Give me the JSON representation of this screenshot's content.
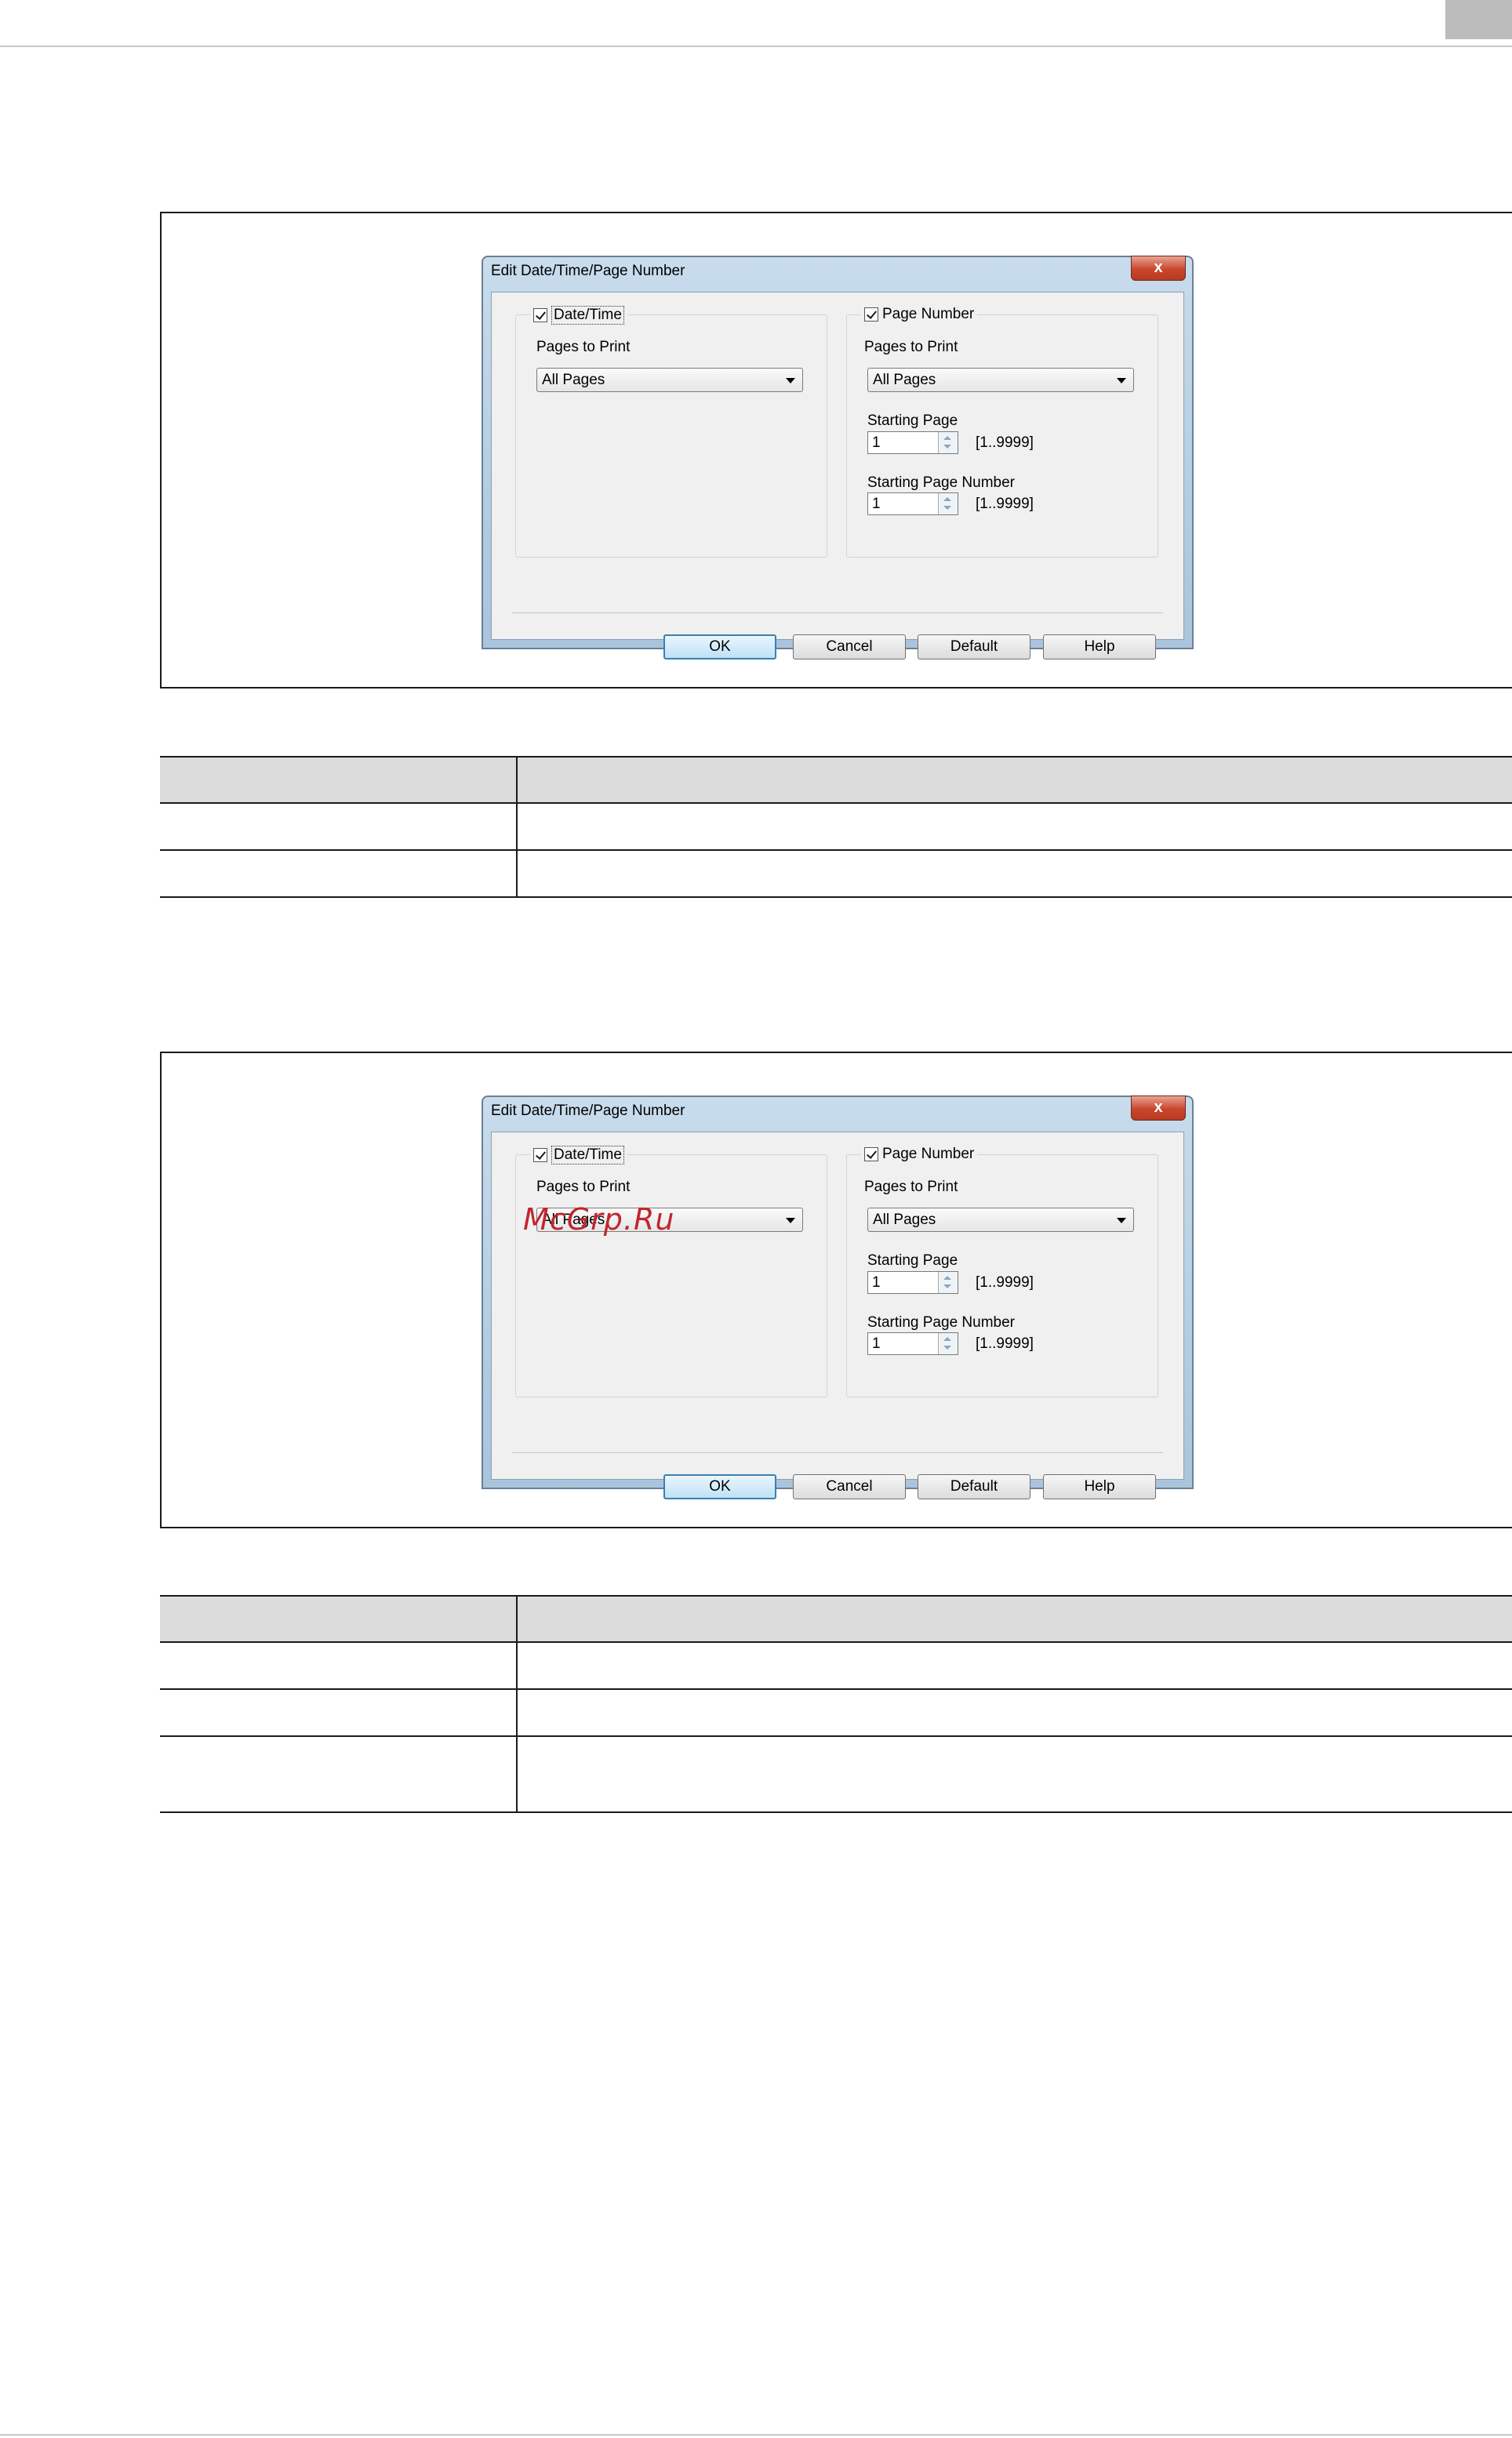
{
  "dialogs": [
    {
      "title": "Edit Date/Time/Page Number",
      "close_glyph": "x",
      "left_group": {
        "checkbox_label": "Date/Time",
        "pages_to_print_label": "Pages to Print",
        "pages_to_print_value": "All Pages"
      },
      "right_group": {
        "checkbox_label": "Page Number",
        "pages_to_print_label": "Pages to Print",
        "pages_to_print_value": "All Pages",
        "starting_page_label": "Starting Page",
        "starting_page_value": "1",
        "starting_page_range": "[1..9999]",
        "starting_page_number_label": "Starting Page Number",
        "starting_page_number_value": "1",
        "starting_page_number_range": "[1..9999]"
      },
      "buttons": {
        "ok": "OK",
        "cancel": "Cancel",
        "default": "Default",
        "help": "Help"
      }
    },
    {
      "title": "Edit Date/Time/Page Number",
      "close_glyph": "x",
      "left_group": {
        "checkbox_label": "Date/Time",
        "pages_to_print_label": "Pages to Print",
        "pages_to_print_value": "All Pages"
      },
      "right_group": {
        "checkbox_label": "Page Number",
        "pages_to_print_label": "Pages to Print",
        "pages_to_print_value": "All Pages",
        "starting_page_label": "Starting Page",
        "starting_page_value": "1",
        "starting_page_range": "[1..9999]",
        "starting_page_number_label": "Starting Page Number",
        "starting_page_number_value": "1",
        "starting_page_number_range": "[1..9999]"
      },
      "buttons": {
        "ok": "OK",
        "cancel": "Cancel",
        "default": "Default",
        "help": "Help"
      }
    }
  ],
  "watermark": "McGrp.Ru"
}
